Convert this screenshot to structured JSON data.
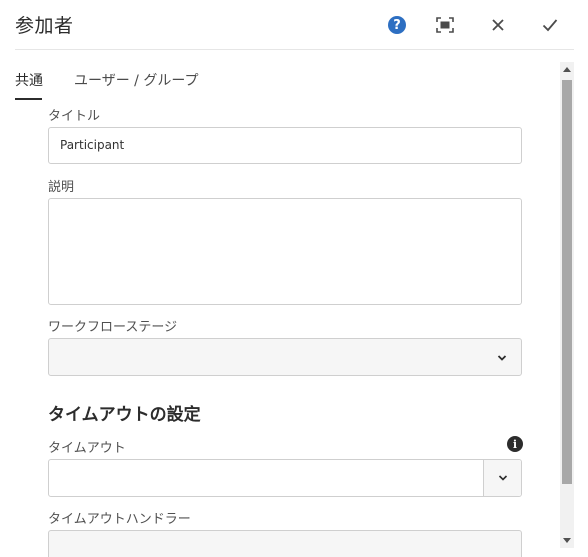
{
  "dialog": {
    "title": "参加者",
    "actions": [
      {
        "name": "help-button",
        "icon": "help-icon",
        "glyph": "?"
      },
      {
        "name": "fullscreen-button",
        "icon": "fullscreen-icon"
      },
      {
        "name": "close-button",
        "icon": "close-icon"
      },
      {
        "name": "done-button",
        "icon": "check-icon"
      }
    ],
    "accent_color": "#2d6fc2"
  },
  "tabs": [
    {
      "label": "共通",
      "active": true
    },
    {
      "label": "ユーザー / グループ",
      "active": false
    }
  ],
  "form": {
    "title_label": "タイトル",
    "title_value": "Participant",
    "description_label": "説明",
    "description_value": "",
    "workflow_stage_label": "ワークフローステージ",
    "workflow_stage_value": "",
    "timeout_section_heading": "タイムアウトの設定",
    "timeout_label": "タイムアウト",
    "timeout_value": "",
    "timeout_info_glyph": "i",
    "timeout_handler_label": "タイムアウトハンドラー"
  }
}
